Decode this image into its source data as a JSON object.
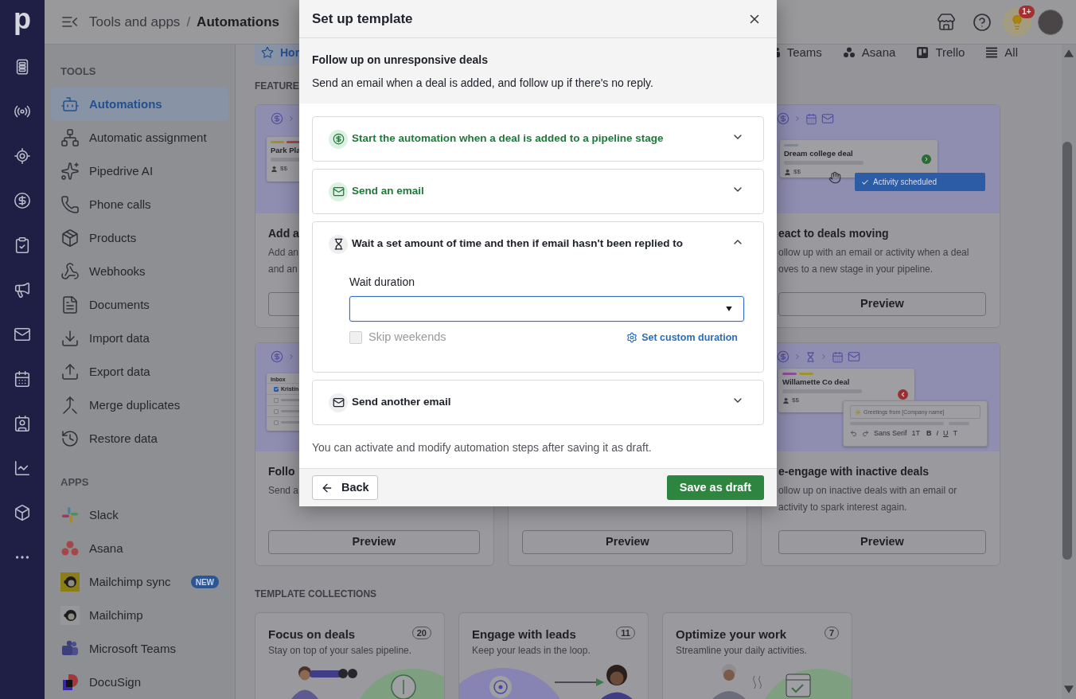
{
  "nav": {
    "logo": "p"
  },
  "header": {
    "breadcrumb": [
      "Tools and apps",
      "Automations"
    ],
    "separator": "/",
    "notification_badge": "1+"
  },
  "sidebar": {
    "sections": [
      {
        "title": "TOOLS",
        "items": [
          {
            "label": "Automations",
            "selected": true
          },
          {
            "label": "Automatic assignment",
            "selected": false
          },
          {
            "label": "Pipedrive AI",
            "selected": false
          },
          {
            "label": "Phone calls",
            "selected": false
          },
          {
            "label": "Products",
            "selected": false
          },
          {
            "label": "Webhooks",
            "selected": false
          },
          {
            "label": "Documents",
            "selected": false
          },
          {
            "label": "Import data",
            "selected": false
          },
          {
            "label": "Export data",
            "selected": false
          },
          {
            "label": "Merge duplicates",
            "selected": false
          },
          {
            "label": "Restore data",
            "selected": false
          }
        ]
      },
      {
        "title": "APPS",
        "items": [
          {
            "label": "Slack",
            "selected": false
          },
          {
            "label": "Asana",
            "selected": false
          },
          {
            "label": "Mailchimp sync",
            "selected": false,
            "badge": "NEW"
          },
          {
            "label": "Mailchimp",
            "selected": false
          },
          {
            "label": "Microsoft Teams",
            "selected": false
          },
          {
            "label": "DocuSign",
            "selected": false
          }
        ]
      }
    ]
  },
  "main": {
    "tabs": [
      {
        "label": "Hor",
        "selected": true
      },
      {
        "label": "Teams",
        "selected": false
      },
      {
        "label": "Asana",
        "selected": false
      },
      {
        "label": "Trello",
        "selected": false
      },
      {
        "label": "All",
        "selected": false
      }
    ],
    "featured_heading": "FEATURE",
    "card_columns": [
      [
        {
          "title": "Add a",
          "description": [
            "Add an",
            "and an"
          ],
          "illustration": {
            "kind": "deal",
            "deal": {
              "name": "Park Pla",
              "amount": "$$",
              "tags": [
                {
                  "color": "#a08e30"
                },
                {
                  "color": "#a44646"
                }
              ]
            }
          }
        },
        {
          "title": "Follo",
          "description": [
            "Send a"
          ],
          "preview": "Preview",
          "illustration": {
            "kind": "inbox",
            "inbox": {
              "title": "Inbox",
              "rows": [
                {
                  "label": "Kristin",
                  "checked": true
                },
                {
                  "checked": false
                },
                {
                  "checked": false
                },
                {
                  "checked": false
                }
              ]
            }
          }
        }
      ],
      [
        {
          "preview": "Preview"
        }
      ],
      [
        {
          "title": "eact to deals moving",
          "description": [
            "ollow up with an email or activity when a deal",
            "oves to a new stage in your pipeline."
          ],
          "preview": "Preview",
          "illustration": {
            "kind": "deal_moved",
            "deal": {
              "name": "Dream college deal",
              "amount": "$$",
              "tags": [
                {
                  "color": "#7a88a0"
                }
              ]
            },
            "toast": "Activity scheduled"
          }
        },
        {
          "title": "e-engage with inactive deals",
          "description": [
            "ollow up on inactive deals with an email or",
            "activity to spark interest again."
          ],
          "preview": "Preview",
          "illustration": {
            "kind": "re_engage",
            "deal": {
              "name": "Willamette Co deal",
              "amount": "$$",
              "tags": [
                {
                  "color": "#8a4f98"
                },
                {
                  "color": "#a09232"
                }
              ]
            },
            "email": {
              "greeting": "Greetings from [Company name]",
              "toolbar": [
                "Sans Serif",
                "1T",
                "B",
                "I",
                "U",
                "T"
              ]
            }
          }
        }
      ]
    ],
    "collections_heading": "TEMPLATE COLLECTIONS",
    "collections": [
      {
        "title": "Focus on deals",
        "count": "20",
        "subtitle": "Stay on top of your sales pipeline."
      },
      {
        "title": "Engage with leads",
        "count": "11",
        "subtitle": "Keep your leads in the loop."
      },
      {
        "title": "Optimize your work",
        "count": "7",
        "subtitle": "Streamline your daily activities."
      }
    ]
  },
  "modal": {
    "title": "Set up template",
    "template_name": "Follow up on unresponsive deals",
    "template_description": "Send an email when a deal is added, and follow up if there's no reply.",
    "steps": [
      {
        "kind": "trigger",
        "label": "Start the automation when a deal is added to a pipeline stage",
        "completed": true,
        "expanded": false
      },
      {
        "kind": "email",
        "label": "Send an email",
        "completed": true,
        "expanded": false
      },
      {
        "kind": "wait",
        "label": "Wait a set amount of time and then if email hasn't been replied to",
        "completed": false,
        "expanded": true,
        "wait_duration": {
          "label": "Wait duration",
          "focused": true
        },
        "skip_weekends": {
          "label": "Skip weekends",
          "checked": false,
          "disabled": true
        },
        "custom_duration_link": "Set custom duration"
      },
      {
        "kind": "email",
        "label": "Send another email",
        "completed": false,
        "expanded": false
      }
    ],
    "note": "You can activate and modify automation steps after saving it as draft.",
    "back_button": "Back",
    "save_button": "Save as draft"
  }
}
